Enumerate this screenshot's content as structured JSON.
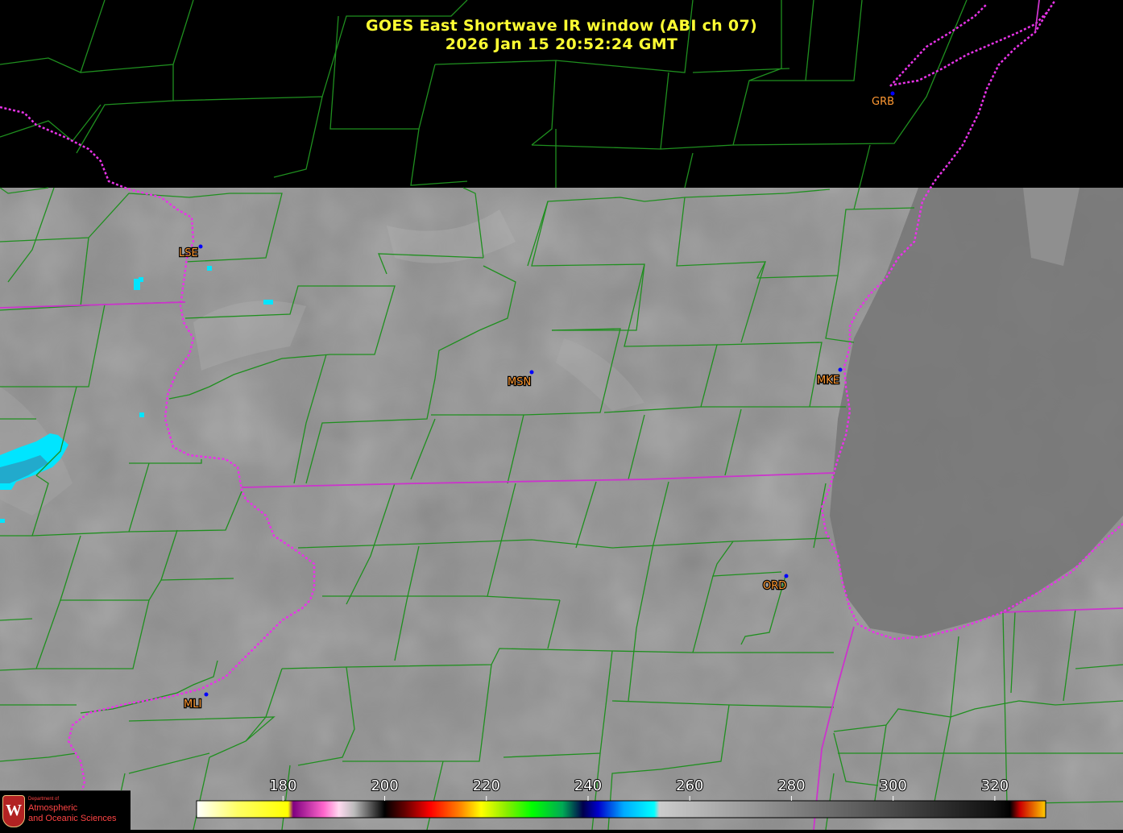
{
  "title": {
    "line1": "GOES East Shortwave IR window (ABI ch 07)",
    "line2": "2026 Jan 15  20:52:24 GMT"
  },
  "stations": [
    {
      "id": "GRB",
      "label": "GRB"
    },
    {
      "id": "LSE",
      "label": "LSE"
    },
    {
      "id": "MSN",
      "label": "MSN"
    },
    {
      "id": "MKE",
      "label": "MKE"
    },
    {
      "id": "ORD",
      "label": "ORD"
    },
    {
      "id": "MLI",
      "label": "MLI"
    }
  ],
  "colorbar": {
    "ticks": [
      "180",
      "200",
      "220",
      "240",
      "260",
      "280",
      "300",
      "320"
    ],
    "tick_values": [
      180,
      200,
      220,
      240,
      260,
      280,
      300,
      320
    ],
    "range": [
      163,
      330
    ],
    "stops": [
      {
        "value": 163,
        "color": "#ffffff"
      },
      {
        "value": 171,
        "color": "#ffff66"
      },
      {
        "value": 181,
        "color": "#ffff00"
      },
      {
        "value": 182,
        "color": "#800080"
      },
      {
        "value": 188,
        "color": "#ff66cc"
      },
      {
        "value": 191,
        "color": "#ffd9f0"
      },
      {
        "value": 194,
        "color": "#bbbbbb"
      },
      {
        "value": 200,
        "color": "#000000"
      },
      {
        "value": 204,
        "color": "#660000"
      },
      {
        "value": 209,
        "color": "#ff0000"
      },
      {
        "value": 215,
        "color": "#ff8800"
      },
      {
        "value": 219,
        "color": "#ffff00"
      },
      {
        "value": 224,
        "color": "#88ee00"
      },
      {
        "value": 229,
        "color": "#00ff00"
      },
      {
        "value": 235,
        "color": "#00aa55"
      },
      {
        "value": 239,
        "color": "#00004d"
      },
      {
        "value": 242,
        "color": "#0000cc"
      },
      {
        "value": 247,
        "color": "#00aaff"
      },
      {
        "value": 253,
        "color": "#00ffff"
      },
      {
        "value": 254,
        "color": "#cccccc"
      },
      {
        "value": 320,
        "color": "#111111"
      },
      {
        "value": 323,
        "color": "#000000"
      },
      {
        "value": 325,
        "color": "#cc0000"
      },
      {
        "value": 330,
        "color": "#ffcc00"
      }
    ]
  },
  "colors": {
    "title": "#ffff33",
    "county_lines": "#1f8f1f",
    "state_lines": "#e833e8",
    "station_label": "#ff9933",
    "station_marker": "#0000ff",
    "cold_cloud": "#00e5ff"
  },
  "logo": {
    "line1": "Department of",
    "line2": "Atmospheric",
    "line3": "and Oceanic Sciences"
  }
}
